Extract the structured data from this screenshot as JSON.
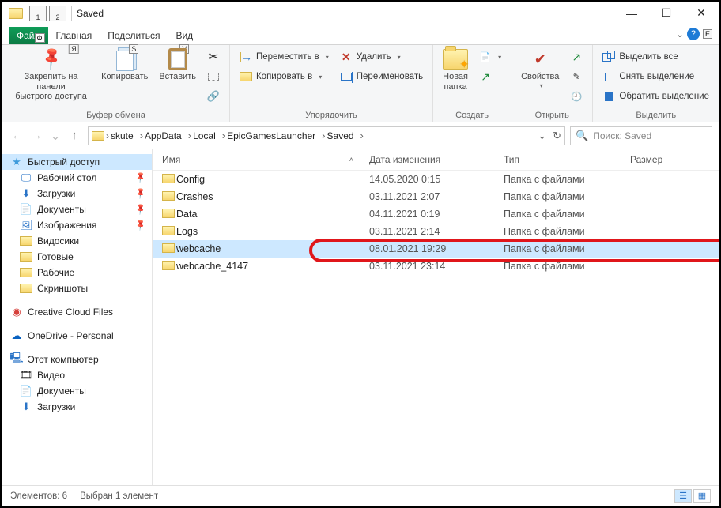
{
  "window": {
    "title": "Saved"
  },
  "qat_keys": [
    "1",
    "2"
  ],
  "tabs": {
    "file": "Файл",
    "file_key": "Ф",
    "home": "Главная",
    "home_key": "Я",
    "share": "Поделиться",
    "share_key": "S",
    "view": "Вид",
    "view_key": "V",
    "help_key": "E"
  },
  "ribbon": {
    "clipboard": {
      "pin": "Закрепить на панели\nбыстрого доступа",
      "copy": "Копировать",
      "paste": "Вставить",
      "cut": "",
      "copy_path": "",
      "paste_shortcut": "",
      "label": "Буфер обмена"
    },
    "organize": {
      "move_to": "Переместить в",
      "copy_to": "Копировать в",
      "delete": "Удалить",
      "rename": "Переименовать",
      "label": "Упорядочить"
    },
    "new": {
      "new_folder": "Новая\nпапка",
      "label": "Создать"
    },
    "open": {
      "properties": "Свойства",
      "label": "Открыть"
    },
    "select": {
      "select_all": "Выделить все",
      "select_none": "Снять выделение",
      "invert": "Обратить выделение",
      "label": "Выделить"
    }
  },
  "breadcrumbs": [
    "skute",
    "AppData",
    "Local",
    "EpicGamesLauncher",
    "Saved"
  ],
  "search_placeholder": "Поиск: Saved",
  "columns": {
    "name": "Имя",
    "date": "Дата изменения",
    "type": "Тип",
    "size": "Размер"
  },
  "rows": [
    {
      "name": "Config",
      "date": "14.05.2020 0:15",
      "type": "Папка с файлами",
      "selected": false
    },
    {
      "name": "Crashes",
      "date": "03.11.2021 2:07",
      "type": "Папка с файлами",
      "selected": false
    },
    {
      "name": "Data",
      "date": "04.11.2021 0:19",
      "type": "Папка с файлами",
      "selected": false
    },
    {
      "name": "Logs",
      "date": "03.11.2021 2:14",
      "type": "Папка с файлами",
      "selected": false
    },
    {
      "name": "webcache",
      "date": "08.01.2021 19:29",
      "type": "Папка с файлами",
      "selected": true
    },
    {
      "name": "webcache_4147",
      "date": "03.11.2021 23:14",
      "type": "Папка с файлами",
      "selected": false
    }
  ],
  "sidebar": {
    "quick": "Быстрый доступ",
    "items_pinned": [
      {
        "label": "Рабочий стол",
        "icon": "desktop"
      },
      {
        "label": "Загрузки",
        "icon": "downloads"
      },
      {
        "label": "Документы",
        "icon": "docs"
      },
      {
        "label": "Изображения",
        "icon": "pics"
      }
    ],
    "items_recent": [
      "Видосики",
      "Готовые",
      "Рабочие",
      "Скриншоты"
    ],
    "creative": "Creative Cloud Files",
    "onedrive": "OneDrive - Personal",
    "this_pc": "Этот компьютер",
    "pc_items": [
      "Видео",
      "Документы",
      "Загрузки"
    ]
  },
  "status": {
    "count": "Элементов: 6",
    "selected": "Выбран 1 элемент"
  }
}
